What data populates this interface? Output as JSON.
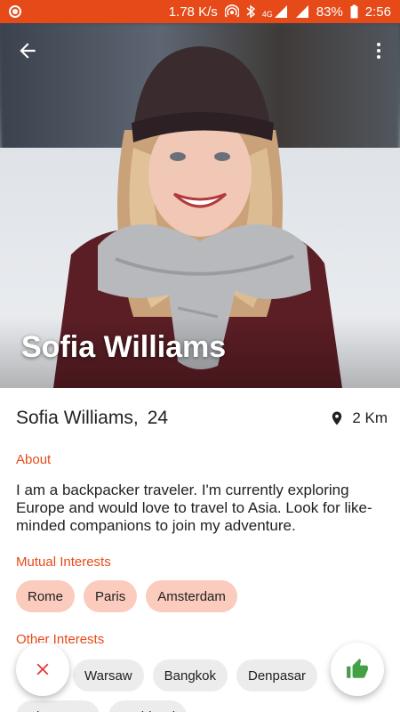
{
  "status_bar": {
    "speed": "1.78 K/s",
    "network": "4G",
    "battery": "83%",
    "time": "2:56"
  },
  "colors": {
    "accent": "#e64a19",
    "mutual_chip": "#fbcbbd",
    "other_chip": "#ececec",
    "like": "#43a047",
    "dislike": "#e53935"
  },
  "toolbar": {
    "back_icon": "arrow-left-icon",
    "menu_icon": "more-vert-icon"
  },
  "profile": {
    "hero_name": "Sofia Williams",
    "name": "Sofia Williams,",
    "age": "24",
    "distance": "2 Km",
    "about_title": "About",
    "about_text": "I am a backpacker traveler. I'm currently exploring Europe and would love to travel to Asia. Look for like-minded companions to join my adventure.",
    "mutual_title": "Mutual Interests",
    "mutual_interests": [
      "Rome",
      "Paris",
      "Amsterdam"
    ],
    "other_title": "Other Interests",
    "other_interests": [
      "Warsaw",
      "Bangkok",
      "Denpasar",
      "Singapore",
      "Krabi Nai"
    ]
  },
  "actions": {
    "dislike_icon": "close-icon",
    "like_icon": "thumb-up-icon"
  }
}
